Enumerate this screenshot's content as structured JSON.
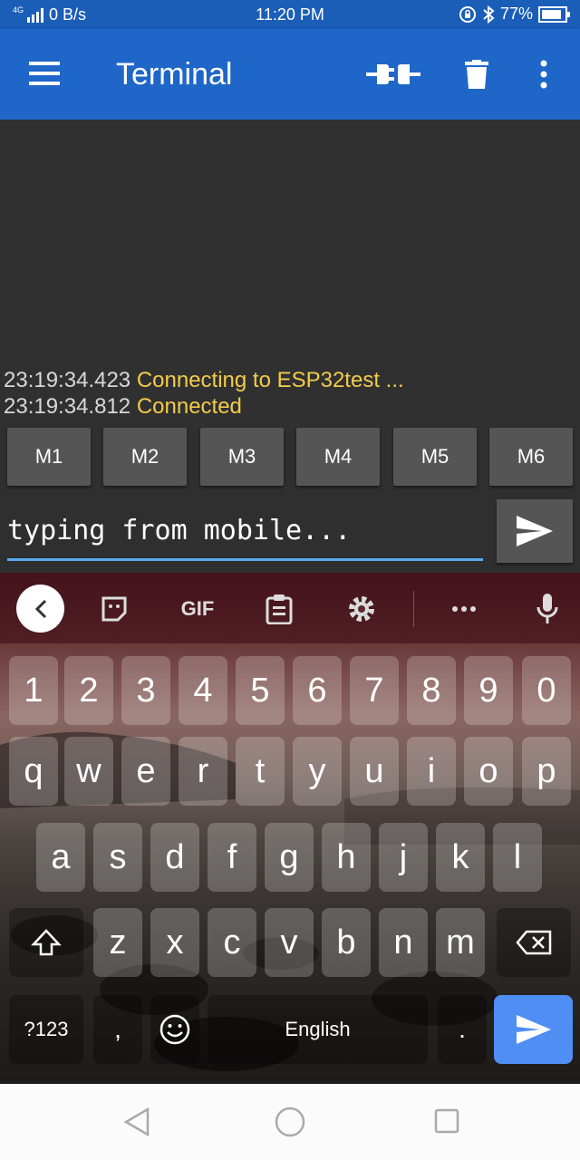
{
  "status_bar": {
    "network": "4G",
    "speed": "0 B/s",
    "time": "11:20 PM",
    "battery": "77%"
  },
  "app_bar": {
    "title": "Terminal",
    "icons": [
      "menu-icon",
      "connect-plug-icon",
      "trash-icon",
      "more-vert-icon"
    ]
  },
  "terminal": {
    "lines": [
      {
        "time": "23:19:34.423",
        "message": "Connecting to ESP32test ..."
      },
      {
        "time": "23:19:34.812",
        "message": "Connected"
      }
    ]
  },
  "macros": [
    "M1",
    "M2",
    "M3",
    "M4",
    "M5",
    "M6"
  ],
  "input": {
    "value": "typing from mobile..."
  },
  "keyboard": {
    "toolbar_icons": [
      "back-icon",
      "sticker-icon",
      "gif-icon",
      "clipboard-icon",
      "gear-icon",
      "more-horiz-icon",
      "mic-icon"
    ],
    "gif_label": "GIF",
    "row_numbers": [
      "1",
      "2",
      "3",
      "4",
      "5",
      "6",
      "7",
      "8",
      "9",
      "0"
    ],
    "row_top": [
      "q",
      "w",
      "e",
      "r",
      "t",
      "y",
      "u",
      "i",
      "o",
      "p"
    ],
    "row_home": [
      "a",
      "s",
      "d",
      "f",
      "g",
      "h",
      "j",
      "k",
      "l"
    ],
    "row_bottom": [
      "z",
      "x",
      "c",
      "v",
      "b",
      "n",
      "m"
    ],
    "symbols_label": "?123",
    "comma_label": ",",
    "space_label": "English",
    "period_label": ".",
    "accent_color": "#4f8ef2"
  },
  "colors": {
    "app_bar": "#1f66c9",
    "log_message": "#f2cc4a",
    "input_underline": "#5aa9ee"
  }
}
